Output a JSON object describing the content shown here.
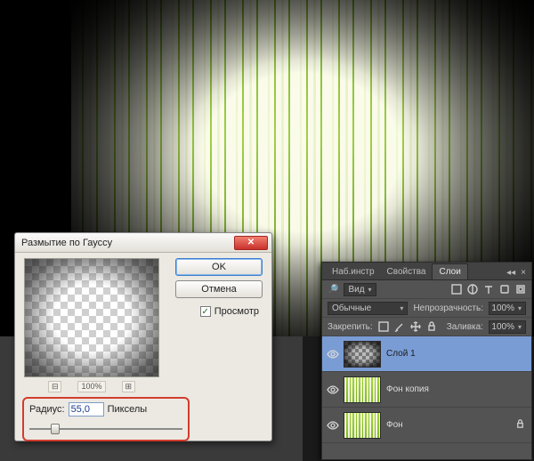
{
  "dialog": {
    "title": "Размытие по Гауссу",
    "ok": "OK",
    "cancel": "Отмена",
    "preview_check": "Просмотр",
    "zoom_percent": "100%",
    "radius_label": "Радиус:",
    "radius_value": "55,0",
    "radius_unit": "Пикселы",
    "slider_pct": 14
  },
  "panel": {
    "tabs": [
      "Наб.инстр",
      "Свойства",
      "Слои"
    ],
    "active_tab": 2,
    "kind_label": "Вид",
    "blend_mode": "Обычные",
    "opacity_label": "Непрозрачность:",
    "opacity_value": "100%",
    "lock_label": "Закрепить:",
    "fill_label": "Заливка:",
    "fill_value": "100%",
    "layers": [
      {
        "name": "Слой 1",
        "thumb": "checker",
        "selected": true,
        "locked": false
      },
      {
        "name": "Фон копия",
        "thumb": "forest",
        "selected": false,
        "locked": false
      },
      {
        "name": "Фон",
        "thumb": "forest",
        "selected": false,
        "locked": true
      }
    ]
  }
}
